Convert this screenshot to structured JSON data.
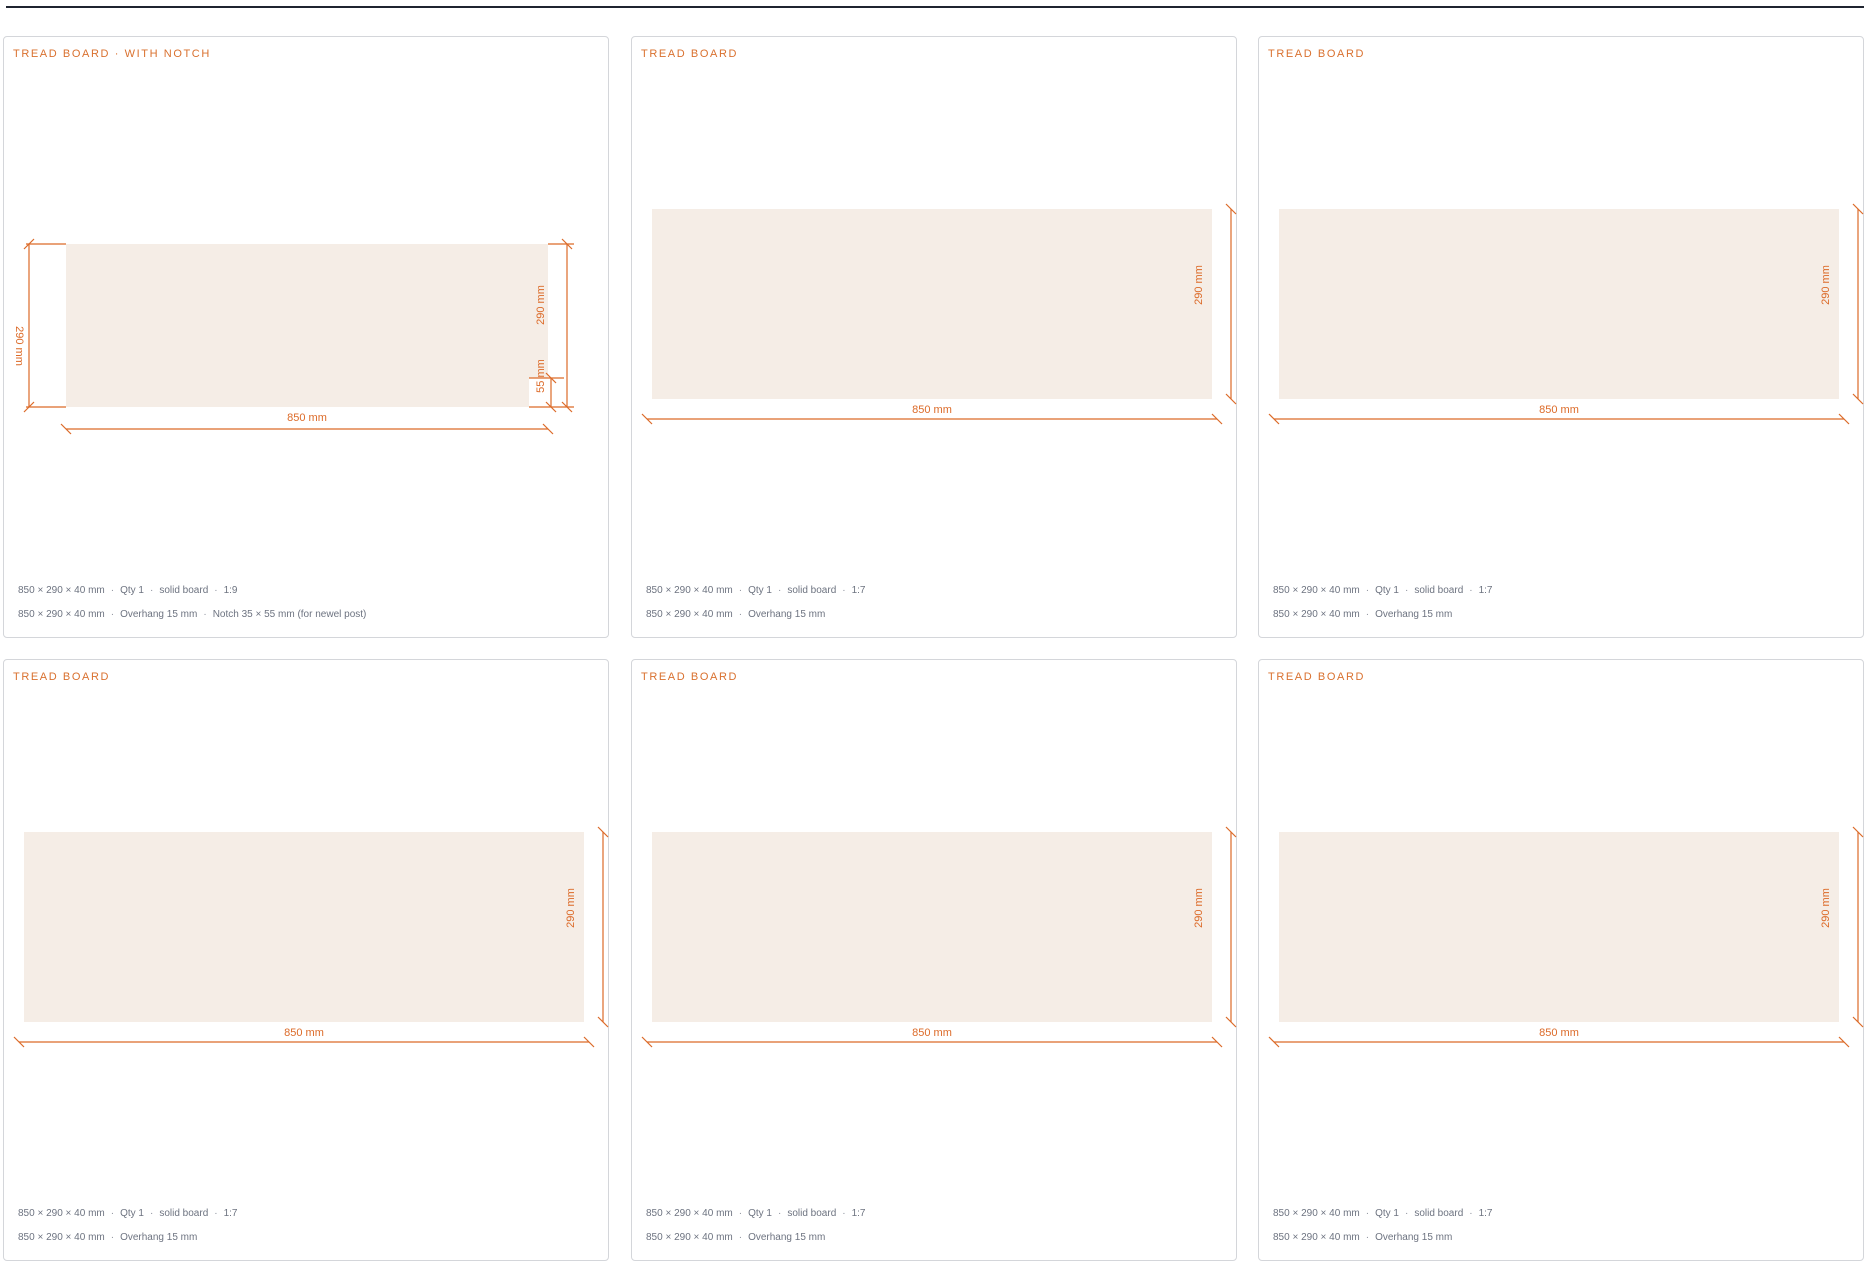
{
  "panels": [
    {
      "title": "TREAD BOARD · WITH NOTCH",
      "width_label": "850 mm",
      "height_label": "290 mm",
      "height_label_left": "290 mm",
      "notch_label": "55 mm",
      "spec_line": [
        "850 × 290 × 40 mm",
        "Qty 1",
        "solid board",
        "1:9"
      ],
      "detail_line": [
        "850 × 290 × 40 mm",
        "Overhang 15 mm",
        "Notch 35 × 55 mm (for newel post)"
      ]
    },
    {
      "title": "TREAD BOARD",
      "width_label": "850 mm",
      "height_label": "290 mm",
      "spec_line": [
        "850 × 290 × 40 mm",
        "Qty 1",
        "solid board",
        "1:7"
      ],
      "detail_line": [
        "850 × 290 × 40 mm",
        "Overhang 15 mm"
      ]
    },
    {
      "title": "TREAD BOARD",
      "width_label": "850 mm",
      "height_label": "290 mm",
      "spec_line": [
        "850 × 290 × 40 mm",
        "Qty 1",
        "solid board",
        "1:7"
      ],
      "detail_line": [
        "850 × 290 × 40 mm",
        "Overhang 15 mm"
      ]
    },
    {
      "title": "TREAD BOARD",
      "width_label": "850 mm",
      "height_label": "290 mm",
      "spec_line": [
        "850 × 290 × 40 mm",
        "Qty 1",
        "solid board",
        "1:7"
      ],
      "detail_line": [
        "850 × 290 × 40 mm",
        "Overhang 15 mm"
      ]
    },
    {
      "title": "TREAD BOARD",
      "width_label": "850 mm",
      "height_label": "290 mm",
      "spec_line": [
        "850 × 290 × 40 mm",
        "Qty 1",
        "solid board",
        "1:7"
      ],
      "detail_line": [
        "850 × 290 × 40 mm",
        "Overhang 15 mm"
      ]
    },
    {
      "title": "TREAD BOARD",
      "width_label": "850 mm",
      "height_label": "290 mm",
      "spec_line": [
        "850 × 290 × 40 mm",
        "Qty 1",
        "solid board",
        "1:7"
      ],
      "detail_line": [
        "850 × 290 × 40 mm",
        "Overhang 15 mm"
      ]
    }
  ],
  "colors": {
    "accent": "#dc6a28",
    "board_fill": "#f5ede6",
    "meta_text": "#6d7380",
    "panel_border": "#d4d6da"
  }
}
